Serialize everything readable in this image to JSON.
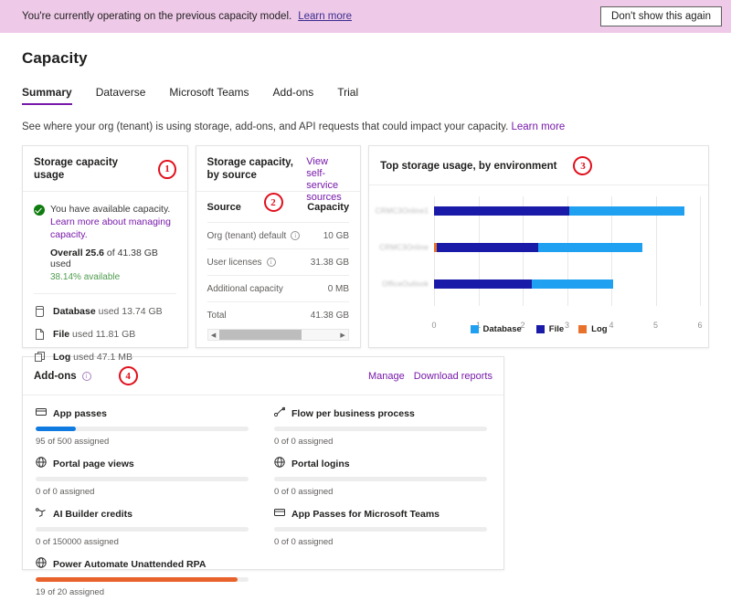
{
  "banner": {
    "text": "You're currently operating on the previous capacity model.",
    "link": "Learn more",
    "dismiss_label": "Don't show this again",
    "background": "#eec9e8"
  },
  "page": {
    "title": "Capacity",
    "subtitle": "See where your org (tenant) is using storage, add-ons, and API requests that could impact your capacity.",
    "subtitle_link": "Learn more",
    "accent": "#7719aa"
  },
  "tabs": [
    {
      "label": "Summary",
      "active": true
    },
    {
      "label": "Dataverse",
      "active": false
    },
    {
      "label": "Microsoft Teams",
      "active": false
    },
    {
      "label": "Add-ons",
      "active": false
    },
    {
      "label": "Trial",
      "active": false
    }
  ],
  "storage_usage": {
    "title": "Storage capacity usage",
    "marker": "1",
    "status_icon": "check-circle-icon",
    "status_text": "You have available capacity.",
    "status_link": "Learn more about managing capacity.",
    "overall_prefix": "Overall",
    "overall_value": "25.6",
    "overall_suffix": "of 41.38 GB used",
    "available_text": "38.14% available",
    "available_color": "#4f9b4f",
    "rows": [
      {
        "icon": "database-icon",
        "name": "Database",
        "value": "used 13.74 GB"
      },
      {
        "icon": "file-icon",
        "name": "File",
        "value": "used 11.81 GB"
      },
      {
        "icon": "log-icon",
        "name": "Log",
        "value": "used 47.1 MB"
      }
    ]
  },
  "storage_by_source": {
    "title": "Storage capacity, by source",
    "link": "View self-service sources",
    "marker": "2",
    "columns": [
      "Source",
      "Capacity"
    ],
    "rows": [
      {
        "source": "Org (tenant) default",
        "info": true,
        "capacity": "10 GB"
      },
      {
        "source": "User licenses",
        "info": true,
        "capacity": "31.38 GB"
      },
      {
        "source": "Additional capacity",
        "info": false,
        "capacity": "0 MB"
      },
      {
        "source": "Total",
        "info": false,
        "capacity": "41.38 GB"
      }
    ],
    "scrollbar_thumb_pct": 70
  },
  "chart_data": {
    "type": "bar",
    "orientation": "horizontal",
    "stacked": true,
    "title": "Top storage usage, by environment",
    "marker": "3",
    "xlabel": "",
    "ylabel": "",
    "xlim": [
      0,
      6
    ],
    "xticks": [
      0,
      1,
      2,
      3,
      4,
      5,
      6
    ],
    "grid": true,
    "legend_position": "bottom",
    "categories": [
      "CRMC3Online1",
      "CRMC3Online",
      "OfficeOutlook"
    ],
    "categories_redacted": true,
    "series": [
      {
        "name": "Log",
        "color": "#e8722c",
        "values": [
          0,
          0.06,
          0
        ]
      },
      {
        "name": "File",
        "color": "#1a1aa8",
        "values": [
          3.05,
          2.29,
          2.2
        ]
      },
      {
        "name": "Database",
        "color": "#1fa0f0",
        "values": [
          2.6,
          2.35,
          1.85
        ]
      }
    ],
    "legend": [
      {
        "label": "Database",
        "color": "#1fa0f0"
      },
      {
        "label": "File",
        "color": "#1a1aa8"
      },
      {
        "label": "Log",
        "color": "#e8722c"
      }
    ]
  },
  "addons": {
    "title": "Add-ons",
    "marker": "4",
    "links": [
      "Manage",
      "Download reports"
    ],
    "items": [
      {
        "icon": "app-passes-icon",
        "label": "App passes",
        "sub": "95 of 500 assigned",
        "pct": 19,
        "color": "#0f7ae0"
      },
      {
        "icon": "flow-icon",
        "label": "Flow per business process",
        "sub": "0 of 0 assigned",
        "pct": 0,
        "color": "#0f7ae0"
      },
      {
        "icon": "globe-icon",
        "label": "Portal page views",
        "sub": "0 of 0 assigned",
        "pct": 0,
        "color": "#0f7ae0"
      },
      {
        "icon": "globe-icon",
        "label": "Portal logins",
        "sub": "0 of 0 assigned",
        "pct": 0,
        "color": "#0f7ae0"
      },
      {
        "icon": "ai-builder-icon",
        "label": "AI Builder credits",
        "sub": "0 of 150000 assigned",
        "pct": 0,
        "color": "#0f7ae0"
      },
      {
        "icon": "app-passes-icon",
        "label": "App Passes for Microsoft Teams",
        "sub": "0 of 0 assigned",
        "pct": 0,
        "color": "#0f7ae0"
      },
      {
        "icon": "globe-icon",
        "label": "Power Automate Unattended RPA",
        "sub": "19 of 20 assigned",
        "pct": 95,
        "color": "#e8622c"
      }
    ]
  }
}
